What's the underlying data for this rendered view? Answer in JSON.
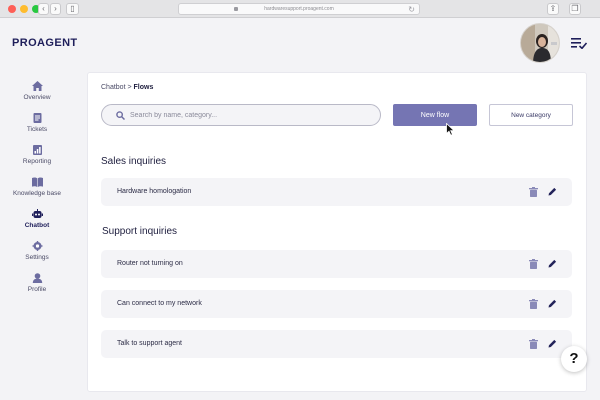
{
  "browser": {
    "url": "hardwaresupport.proagent.com",
    "back_icon": "chevron-left-icon",
    "forward_icon": "chevron-right-icon",
    "sidebar_toggle_icon": "sidebar-icon",
    "share_icon": "share-icon",
    "tabs_icon": "tabs-icon",
    "reload_icon": "reload-icon"
  },
  "header": {
    "logo": "PROAGENT",
    "menu_icon": "menu-check-icon"
  },
  "sidebar": {
    "items": [
      {
        "label": "Overview",
        "icon": "home-icon"
      },
      {
        "label": "Tickets",
        "icon": "ticket-icon"
      },
      {
        "label": "Reporting",
        "icon": "chart-icon"
      },
      {
        "label": "Knowledge base",
        "icon": "book-icon"
      },
      {
        "label": "Chatbot",
        "icon": "robot-icon",
        "active": true
      },
      {
        "label": "Settings",
        "icon": "gear-icon"
      },
      {
        "label": "Profile",
        "icon": "user-icon"
      }
    ]
  },
  "main": {
    "breadcrumb": {
      "parent": "Chatbot",
      "separator": ">",
      "current": "Flows"
    },
    "search": {
      "placeholder": "Search by name, category...",
      "value": ""
    },
    "new_flow_label": "New flow",
    "new_category_label": "New category",
    "categories": [
      {
        "title": "Sales inquiries",
        "flows": [
          "Hardware homologation"
        ]
      },
      {
        "title": "Support inquiries",
        "flows": [
          "Router not turning on",
          "Can connect to my network",
          "Talk to support agent"
        ]
      }
    ]
  },
  "help": {
    "label": "?"
  },
  "colors": {
    "accent": "#7575b3",
    "brand_dark": "#1e1e5a",
    "row_bg": "#f4f4f7",
    "icon_muted": "#8a8ab8",
    "icon_dark": "#23235a"
  }
}
